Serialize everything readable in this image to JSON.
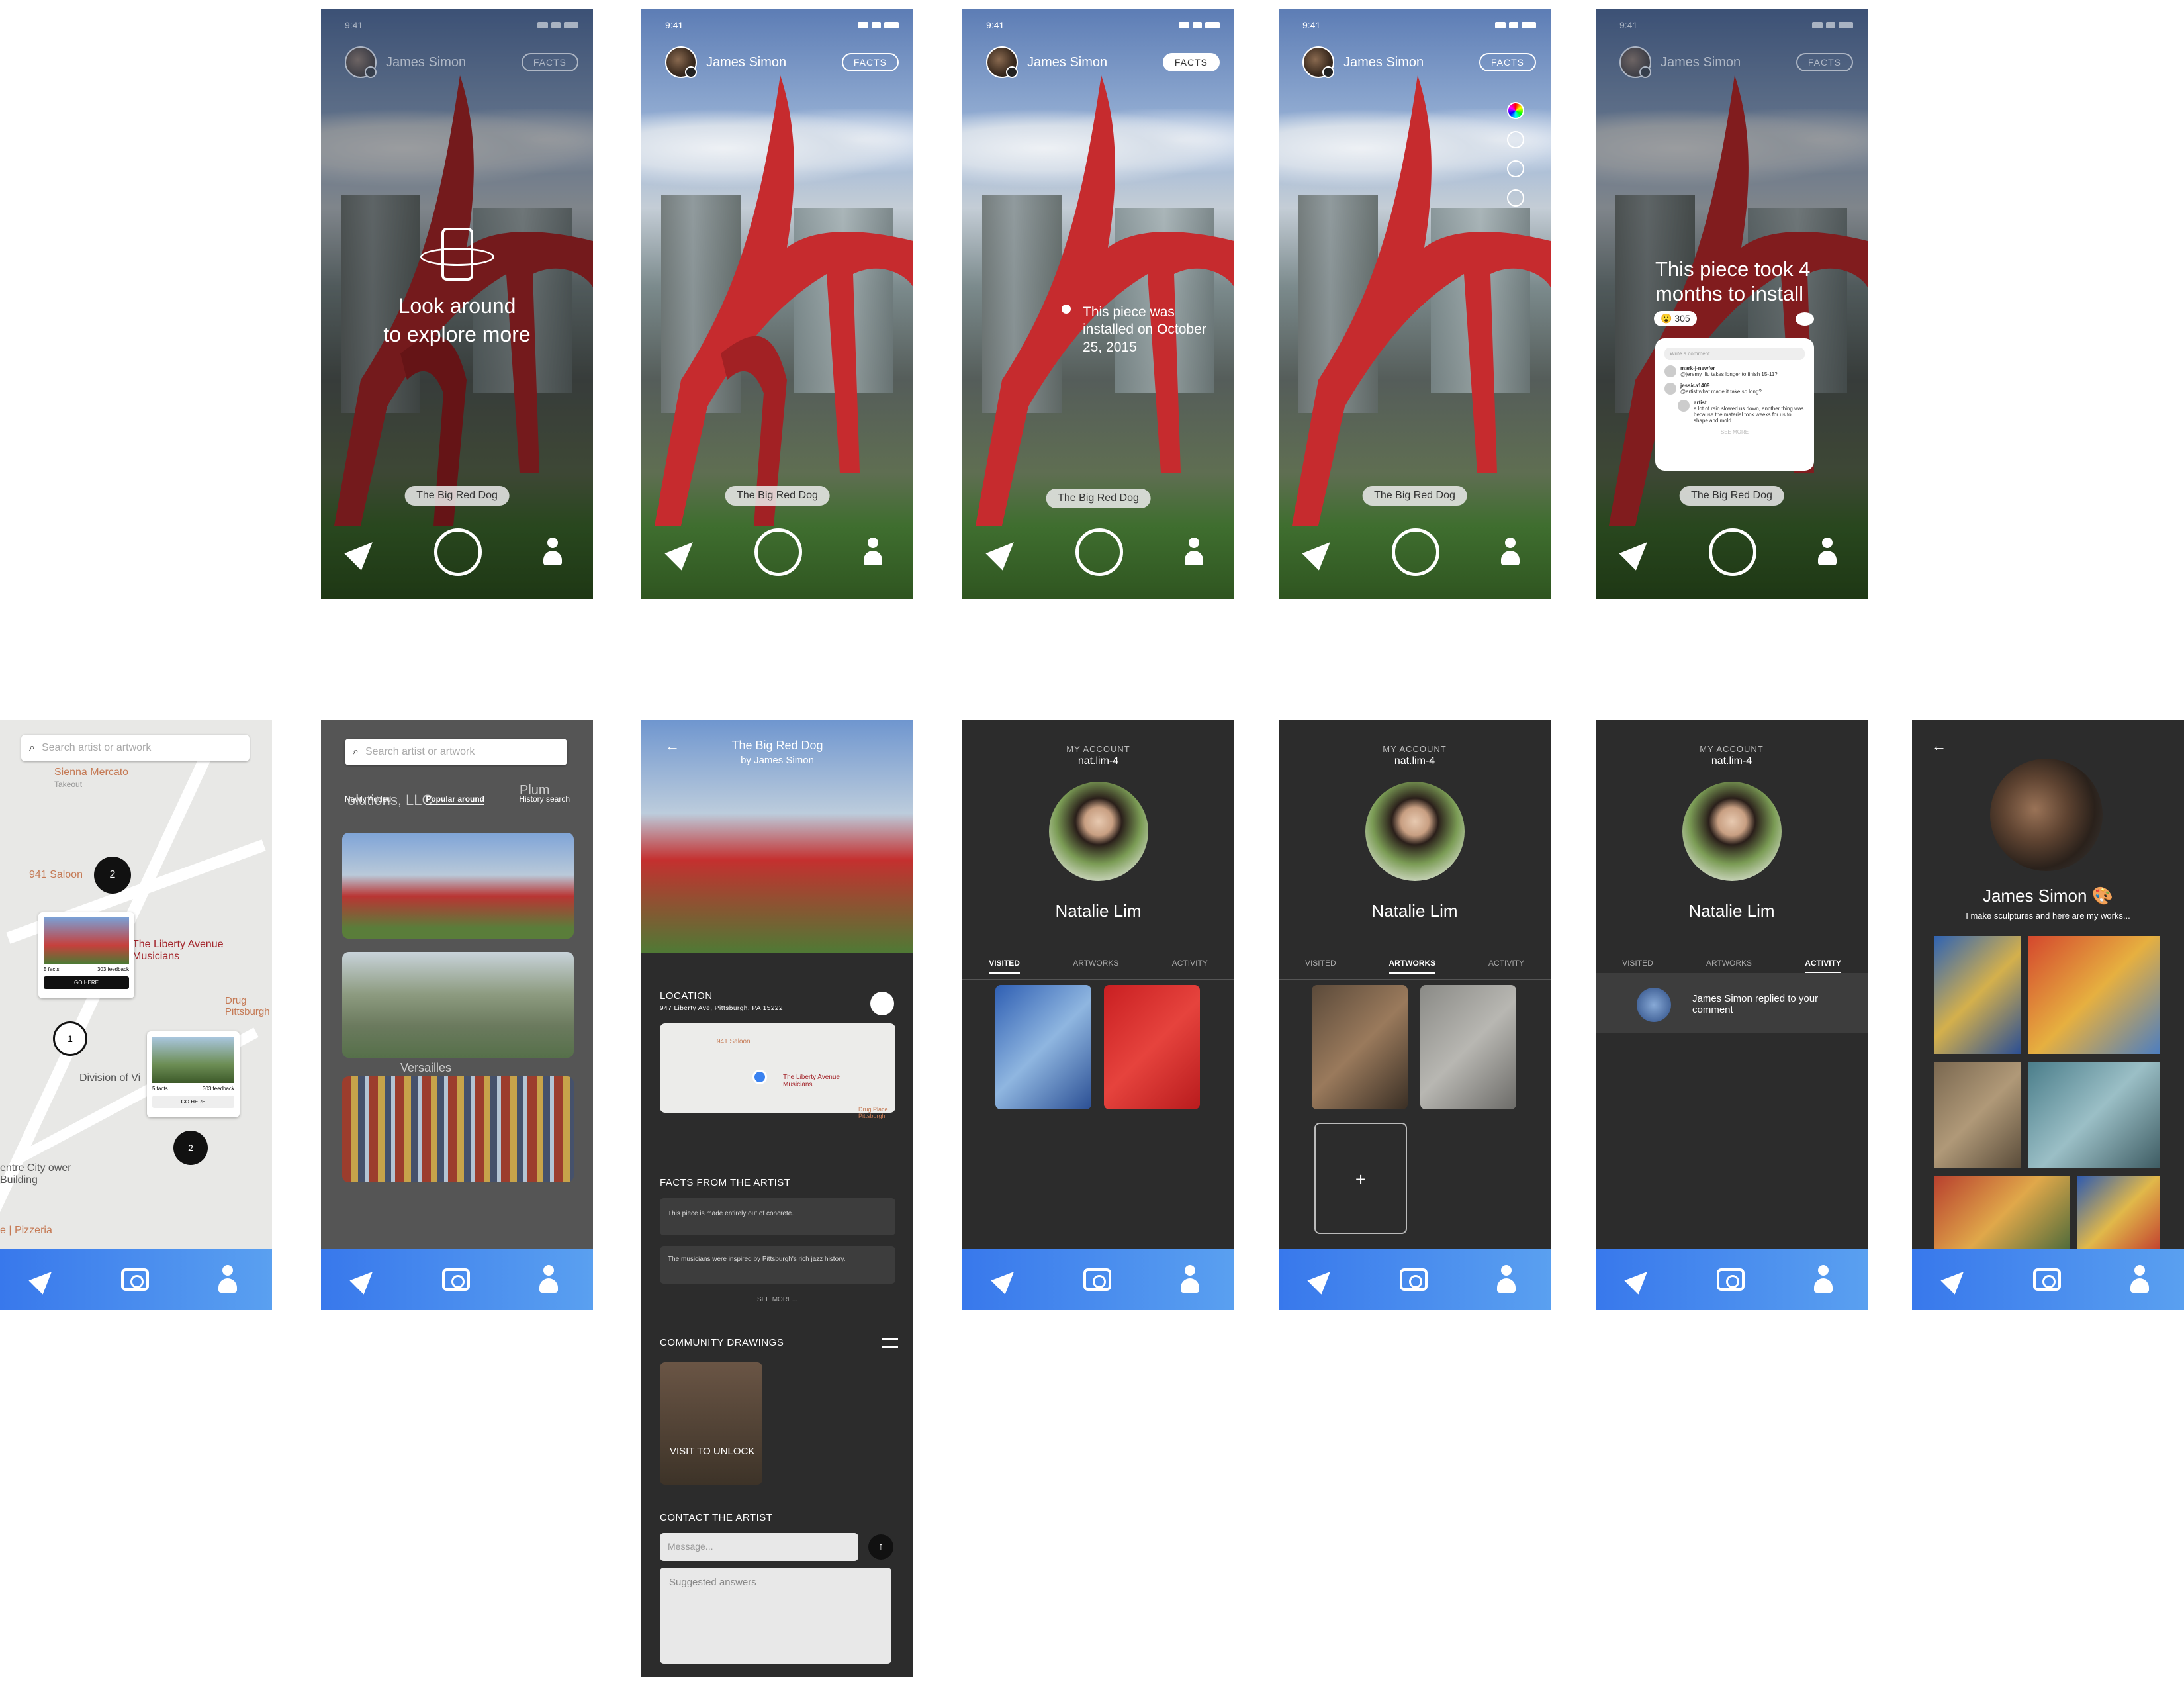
{
  "screens_ar": {
    "time": "9:41",
    "user": "James Simon",
    "facts_label": "FACTS",
    "artwork_label": "The Big Red Dog",
    "look_around": "Look around",
    "explore_more": "to explore more",
    "fact_popup": "This piece was installed on October 25, 2015",
    "fact_big": "This piece took 4 months to install",
    "reaction_count": "305",
    "comment_placeholder": "Write a comment...",
    "comments": [
      {
        "user": "mark-j-newfer",
        "text": "@jeremy_liu takes longer to finish 15-11?"
      },
      {
        "user": "jessica1409",
        "text": "@artist what made it take so long?"
      },
      {
        "user": "artist",
        "text": "a lot of rain slowed us down, another thing was because the material took weeks for us to shape and mold"
      }
    ],
    "see_more": "SEE MORE"
  },
  "map_screen": {
    "search_placeholder": "Search artist or artwork",
    "places": [
      "Sienna Mercato",
      "Takeout",
      "941 Saloon",
      "The Liberty Avenue Musicians",
      "Division of Vi",
      "entre City ower Building",
      "e | Pizzeria",
      "Drug Pittsburgh"
    ],
    "pin_counts": [
      "2",
      "1",
      "2"
    ],
    "card_facts": "5 facts",
    "card_feedback": "303 feedback",
    "go_here": "GO HERE"
  },
  "list_screen": {
    "search_placeholder": "Search artist or artwork",
    "tabs": [
      "Newly Added",
      "Popular around",
      "History search"
    ],
    "bg_texts": [
      "Plum",
      "olutions, LLC",
      "Versailles"
    ]
  },
  "detail": {
    "title": "The Big Red Dog",
    "by": "by James Simon",
    "location_label": "LOCATION",
    "address": "947 Liberty Ave, Pittsburgh, PA 15222",
    "map_labels": [
      "941 Saloon",
      "The Liberty Avenue Musicians",
      "Drug Place Pittsburgh"
    ],
    "facts_label": "FACTS FROM THE ARTIST",
    "facts": [
      "This piece is made entirely out of concrete.",
      "The musicians were inspired by Pittsburgh's rich jazz history."
    ],
    "see_more": "SEE MORE...",
    "community_label": "COMMUNITY DRAWINGS",
    "unlock": "VISIT TO UNLOCK",
    "contact_label": "CONTACT THE ARTIST",
    "message_placeholder": "Message...",
    "suggested": "Suggested answers"
  },
  "account": {
    "my_account": "MY ACCOUNT",
    "handle": "nat.lim-4",
    "name": "Natalie Lim",
    "tabs": [
      "VISITED",
      "ARTWORKS",
      "ACTIVITY"
    ],
    "activity_text": "James Simon replied to your comment"
  },
  "artist": {
    "name": "James Simon",
    "bio": "I make sculptures and here are my works..."
  }
}
